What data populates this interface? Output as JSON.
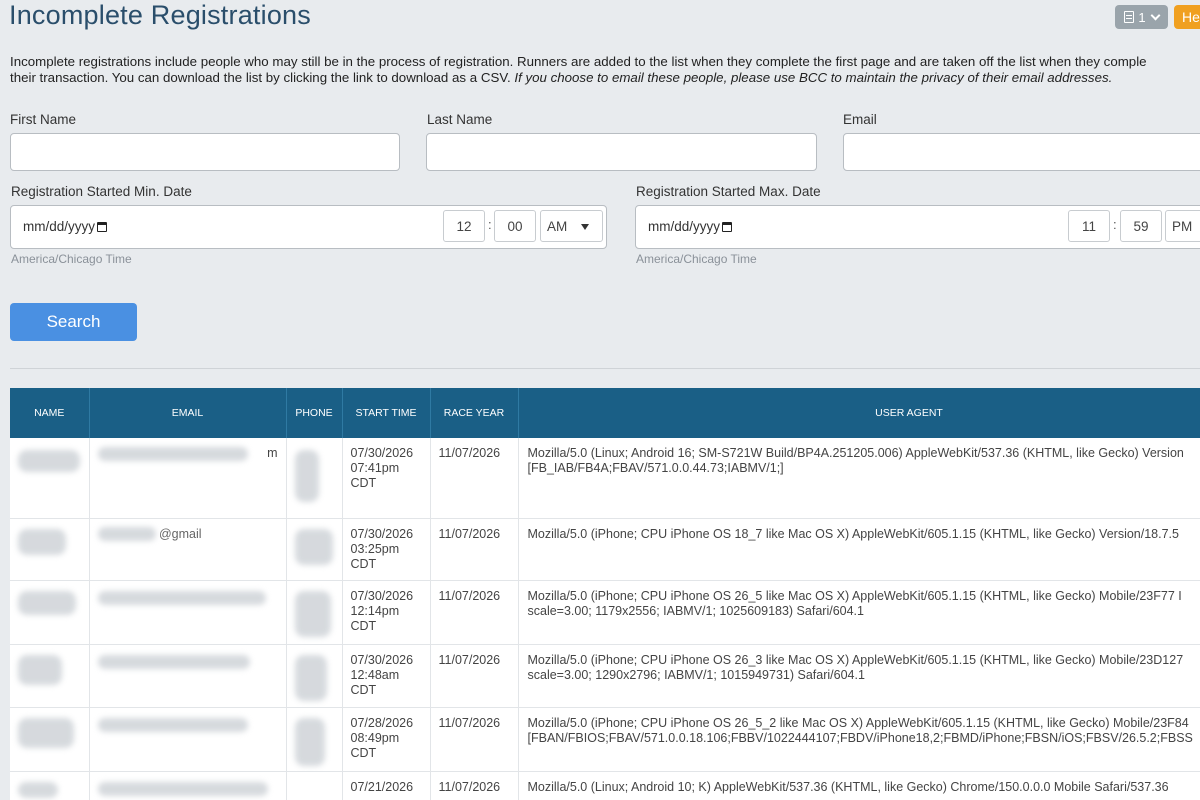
{
  "header": {
    "title": "Incomplete Registrations",
    "menu_count": "1",
    "help_label": "He",
    "menu_icon": "document-icon",
    "menu_chevron_icon": "chevron-down-icon"
  },
  "description": {
    "line1": "Incomplete registrations include people who may still be in the process of registration. Runners are added to the list when they complete the first page and are taken off the list when they comple",
    "line2_plain": "their transaction. You can download the list by clicking the link to download as a CSV.",
    "line2_italic": "If you choose to email these people, please use BCC to maintain the privacy of their email addresses."
  },
  "filters": {
    "first_name_label": "First Name",
    "last_name_label": "Last Name",
    "email_label": "Email",
    "min_date": {
      "label": "Registration Started Min. Date",
      "date_placeholder": "mm/dd/yyyy",
      "hour": "12",
      "minute": "00",
      "ampm": "AM",
      "timezone_note": "America/Chicago Time"
    },
    "max_date": {
      "label": "Registration Started Max. Date",
      "date_placeholder": "mm/dd/yyyy",
      "hour": "11",
      "minute": "59",
      "ampm": "PM",
      "timezone_note": "America/Chicago Time"
    },
    "time_separator": ":",
    "search_label": "Search"
  },
  "table": {
    "columns": [
      "NAME",
      "EMAIL",
      "PHONE",
      "START TIME",
      "RACE YEAR",
      "USER AGENT"
    ],
    "rows": [
      {
        "name_visible": "",
        "email_visible": "m",
        "start_date": "07/30/2026",
        "start_time": "07:41pm",
        "tz": "CDT",
        "race_year": "11/07/2026",
        "ua_line1": "Mozilla/5.0 (Linux; Android 16; SM-S721W Build/BP4A.251205.006) AppleWebKit/537.36 (KHTML, like Gecko) Version",
        "ua_line2": "[FB_IAB/FB4A;FBAV/571.0.0.44.73;IABMV/1;]"
      },
      {
        "name_visible": "",
        "email_visible": "@gmail",
        "start_date": "07/30/2026",
        "start_time": "03:25pm",
        "tz": "CDT",
        "race_year": "11/07/2026",
        "ua_line1": "Mozilla/5.0 (iPhone; CPU iPhone OS 18_7 like Mac OS X) AppleWebKit/605.1.15 (KHTML, like Gecko) Version/18.7.5",
        "ua_line2": ""
      },
      {
        "name_visible": "",
        "email_visible": "",
        "start_date": "07/30/2026",
        "start_time": "12:14pm",
        "tz": "CDT",
        "race_year": "11/07/2026",
        "ua_line1": "Mozilla/5.0 (iPhone; CPU iPhone OS 26_5 like Mac OS X) AppleWebKit/605.1.15 (KHTML, like Gecko) Mobile/23F77 I",
        "ua_line2": "scale=3.00; 1179x2556; IABMV/1; 1025609183) Safari/604.1"
      },
      {
        "name_visible": "",
        "email_visible": "",
        "start_date": "07/30/2026",
        "start_time": "12:48am",
        "tz": "CDT",
        "race_year": "11/07/2026",
        "ua_line1": "Mozilla/5.0 (iPhone; CPU iPhone OS 26_3 like Mac OS X) AppleWebKit/605.1.15 (KHTML, like Gecko) Mobile/23D127",
        "ua_line2": "scale=3.00; 1290x2796; IABMV/1; 1015949731) Safari/604.1"
      },
      {
        "name_visible": "",
        "email_visible": "",
        "start_date": "07/28/2026",
        "start_time": "08:49pm",
        "tz": "CDT",
        "race_year": "11/07/2026",
        "ua_line1": "Mozilla/5.0 (iPhone; CPU iPhone OS 26_5_2 like Mac OS X) AppleWebKit/605.1.15 (KHTML, like Gecko) Mobile/23F84",
        "ua_line2": "[FBAN/FBIOS;FBAV/571.0.0.18.106;FBBV/1022444107;FBDV/iPhone18,2;FBMD/iPhone;FBSN/iOS;FBSV/26.5.2;FBSS"
      },
      {
        "name_visible": "",
        "email_visible": "",
        "start_date": "07/21/2026",
        "start_time": "",
        "tz": "",
        "race_year": "11/07/2026",
        "ua_line1": "Mozilla/5.0 (Linux; Android 10; K) AppleWebKit/537.36 (KHTML, like Gecko) Chrome/150.0.0.0 Mobile Safari/537.36",
        "ua_line2": ""
      }
    ]
  }
}
